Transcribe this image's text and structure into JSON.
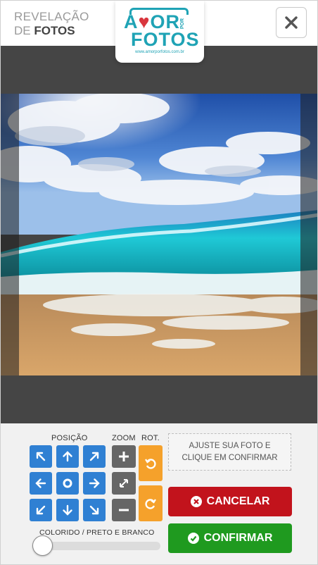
{
  "header": {
    "brand_line1": "REVELAÇÃO",
    "brand_line2_prefix": "DE",
    "brand_line2_bold": "FOTOS",
    "close_label": "×"
  },
  "logo": {
    "word1_a": "A",
    "word1_rest": "OR",
    "word_pos": "POR",
    "word2": "FOTOS",
    "url": "www.amorporfotos.com.br"
  },
  "controls": {
    "position_label": "POSIÇÃO",
    "zoom_label": "ZOOM",
    "rot_label": "ROT.",
    "hint_line1": "AJUSTE SUA FOTO E",
    "hint_line2": "CLIQUE EM CONFIRMAR",
    "cancel_label": "CANCELAR",
    "confirm_label": "CONFIRMAR",
    "color_mode_label": "COLORIDO / PRETO E BRANCO",
    "color_mode_value": 0
  },
  "colors": {
    "accent_blue": "#2f80d3",
    "zoom_gray": "#666666",
    "rotate_orange": "#f5a12b",
    "cancel_red": "#c2131c",
    "confirm_green": "#1f9a1f",
    "logo_teal": "#1fa3b5"
  },
  "icons": {
    "position_pad": [
      "arrow-up-left-icon",
      "arrow-up-icon",
      "arrow-up-right-icon",
      "arrow-left-icon",
      "center-icon",
      "arrow-right-icon",
      "arrow-down-left-icon",
      "arrow-down-icon",
      "arrow-down-right-icon"
    ],
    "zoom": [
      "plus-icon",
      "expand-icon",
      "minus-icon"
    ],
    "rotate": [
      "rotate-left-icon",
      "rotate-right-icon"
    ]
  }
}
